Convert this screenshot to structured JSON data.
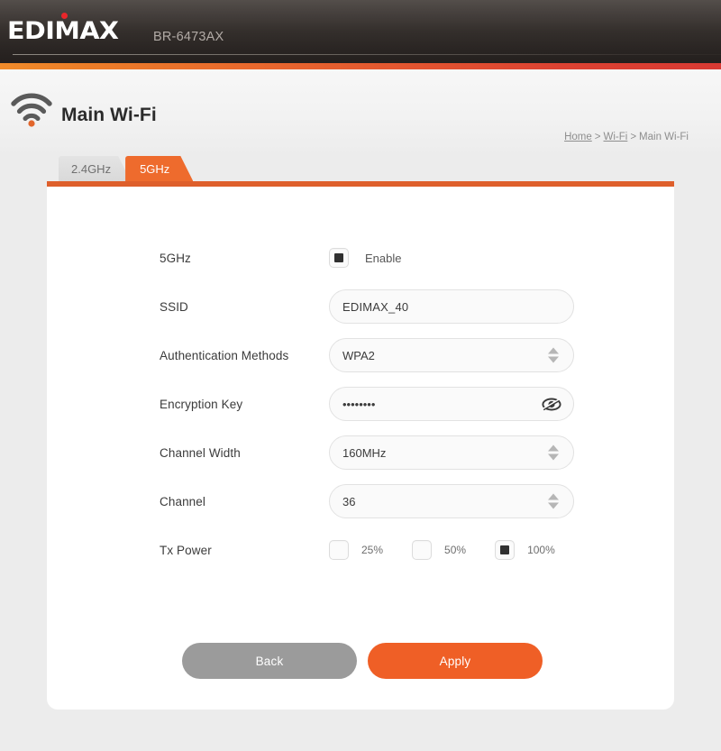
{
  "header": {
    "logo_text": "EDIMAX",
    "model": "BR-6473AX"
  },
  "page": {
    "title": "Main Wi-Fi",
    "icon": "wifi-icon"
  },
  "breadcrumb": {
    "home": "Home",
    "sep1": ">",
    "wifi": "Wi-Fi",
    "sep2": ">",
    "current": "Main Wi-Fi"
  },
  "tabs": [
    {
      "label": "2.4GHz",
      "active": false
    },
    {
      "label": "5GHz",
      "active": true
    }
  ],
  "form": {
    "band": {
      "label": "5GHz",
      "checkbox_label": "Enable",
      "checked": true
    },
    "ssid": {
      "label": "SSID",
      "value": "EDIMAX_40",
      "placeholder": "SSID"
    },
    "auth": {
      "label": "Authentication Methods",
      "value": "WPA2",
      "options": [
        "WPA2"
      ]
    },
    "key": {
      "label": "Encryption Key",
      "value": "••••••••",
      "placeholder": "Encryption Key",
      "reveal_icon": "eye-slash-icon",
      "masked": true
    },
    "channel_width": {
      "label": "Channel Width",
      "value": "160MHz",
      "options": [
        "160MHz"
      ]
    },
    "channel": {
      "label": "Channel",
      "value": "36",
      "options": [
        "36"
      ]
    },
    "tx_power": {
      "label": "Tx Power",
      "options": [
        {
          "label": "25%",
          "checked": false
        },
        {
          "label": "50%",
          "checked": false
        },
        {
          "label": "100%",
          "checked": true
        }
      ]
    }
  },
  "buttons": {
    "back": "Back",
    "apply": "Apply"
  },
  "colors": {
    "accent_orange": "#ef5f26",
    "tab_active": "#ee6b2d",
    "tab_bar": "#de5f2b",
    "logo_dot_red": "#e8262a",
    "btn_back_gray": "#9b9b9b",
    "page_bg": "#ececec"
  }
}
